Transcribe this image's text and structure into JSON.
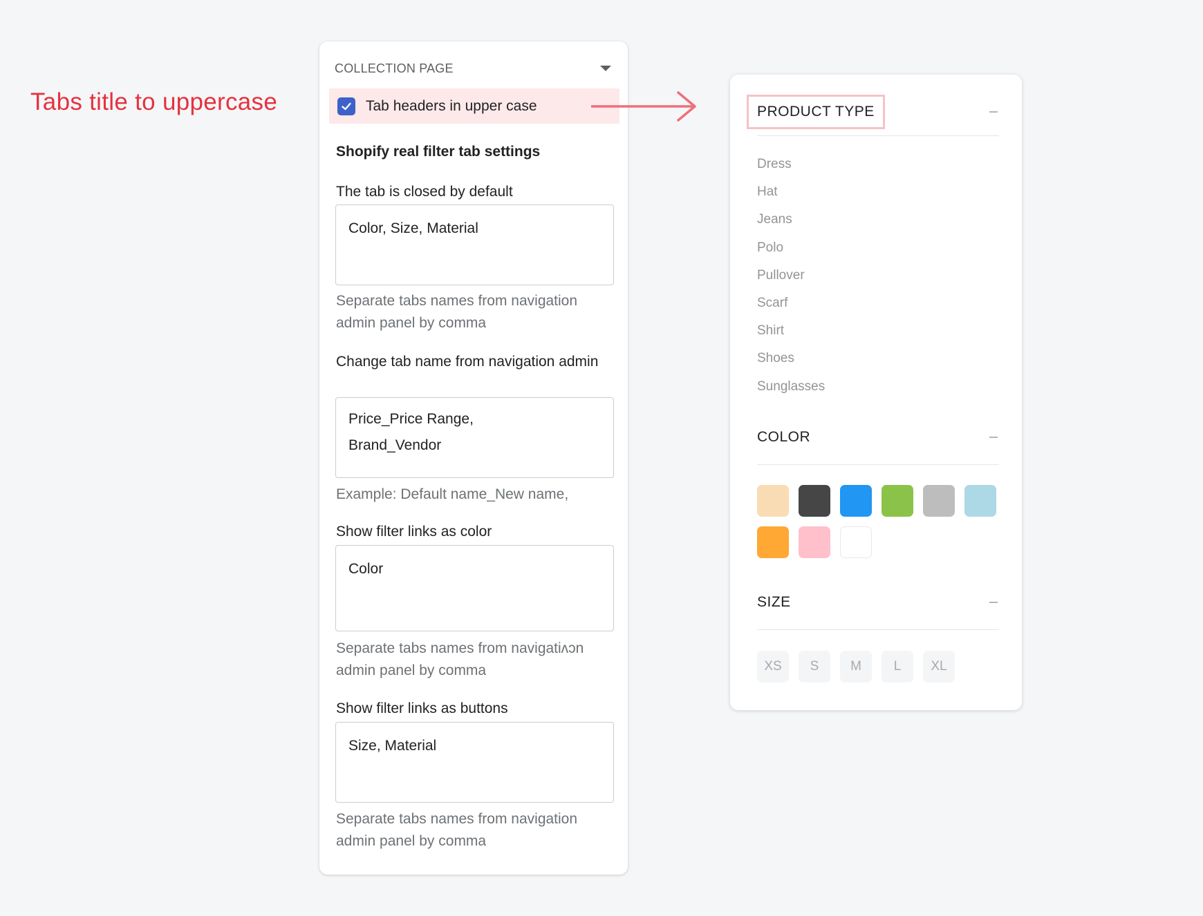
{
  "annotation": {
    "caption": "Tabs title to uppercase",
    "color": "#e5323e",
    "arrow_color": "#ee6f7a"
  },
  "settings": {
    "title": "COLLECTION PAGE",
    "checkbox": {
      "label": "Tab headers in upper case",
      "checked": true,
      "color": "#3e61c9"
    },
    "section_title": "Shopify real filter tab settings",
    "fields": [
      {
        "label": "The tab is closed by default",
        "value": "Color, Size, Material",
        "help": "Separate tabs names from navigation admin panel by comma"
      },
      {
        "label": "Change tab name from navigation admin",
        "value": "Price_Price Range,\nBrand_Vendor",
        "help": "Example: Default name_New name,"
      },
      {
        "label": "Show filter links as color",
        "value": "Color",
        "help": "Separate tabs names from navigatiʌɔn admin panel by comma"
      },
      {
        "label": "Show filter links as buttons",
        "value": "Size, Material",
        "help": "Separate tabs names from navigation admin panel by comma"
      }
    ]
  },
  "filter": {
    "groups": [
      {
        "title": "PRODUCT TYPE",
        "items": [
          "Dress",
          "Hat",
          "Jeans",
          "Polo",
          "Pullover",
          "Scarf",
          "Shirt",
          "Shoes",
          "Sunglasses"
        ]
      },
      {
        "title": "COLOR",
        "swatches": [
          "#fadcb4",
          "#464646",
          "#2196f3",
          "#8bc34a",
          "#bdbdbd",
          "#add8e6",
          "#ffa834",
          "#ffc0cb",
          "#ffffff"
        ]
      },
      {
        "title": "SIZE",
        "sizes": [
          "XS",
          "S",
          "M",
          "L",
          "XL"
        ]
      }
    ]
  }
}
